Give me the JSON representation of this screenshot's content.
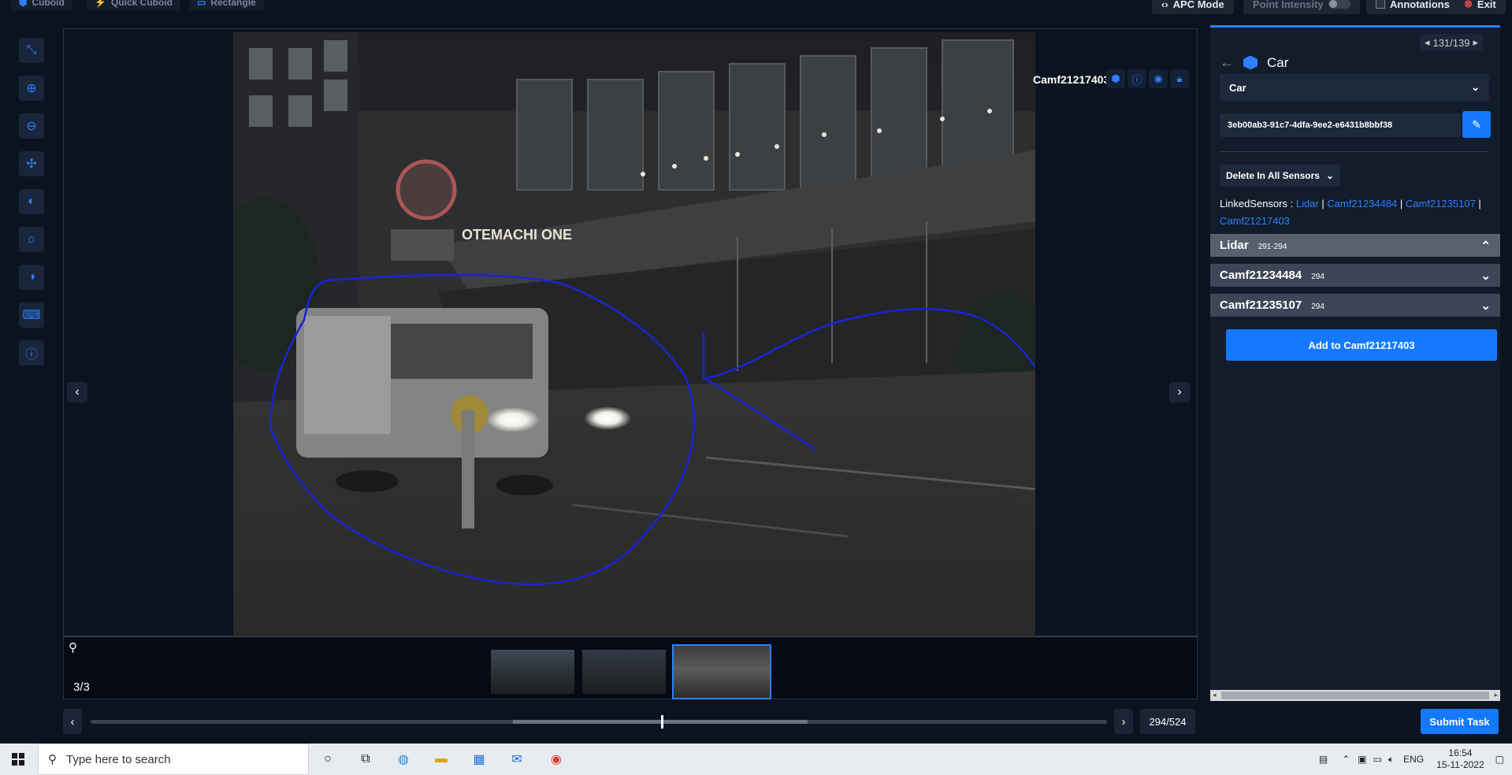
{
  "toolbar": {
    "cuboid_label": "Cuboid",
    "quick_cuboid_label": "Quick Cuboid",
    "rectangle_label": "Rectangle",
    "apc_mode_label": "APC Mode",
    "point_intensity_label": "Point Intensity",
    "annotations_label": "Annotations",
    "exit_label": "Exit"
  },
  "viewer": {
    "camera_name": "Camf21217403",
    "frame_counter": "3/3"
  },
  "timeline": {
    "frame_count": "294/524",
    "progress_fraction": 0.561
  },
  "panel": {
    "pager": "131/139",
    "object_class": "Car",
    "class_select_value": "Car",
    "object_id": "3eb00ab3-91c7-4dfa-9ee2-e6431b8bbf38",
    "delete_label": "Delete In All Sensors",
    "linked_label": "LinkedSensors :",
    "linked_sensors": [
      "Lidar",
      "Camf21234484",
      "Camf21235107",
      "Camf21217403"
    ],
    "sections": [
      {
        "name": "Lidar",
        "range": "291-294",
        "expanded": true
      },
      {
        "name": "Camf21234484",
        "range": "294",
        "expanded": false
      },
      {
        "name": "Camf21235107",
        "range": "294",
        "expanded": false
      }
    ],
    "add_button_label": "Add to Camf21217403"
  },
  "submit_label": "Submit Task",
  "taskbar": {
    "search_placeholder": "Type here to search",
    "language": "ENG",
    "time": "16:54",
    "date": "15-11-2022"
  },
  "colors": {
    "accent": "#1479ff",
    "panel_bg": "#121c2b",
    "annotation_stroke": "#1a22d8"
  }
}
